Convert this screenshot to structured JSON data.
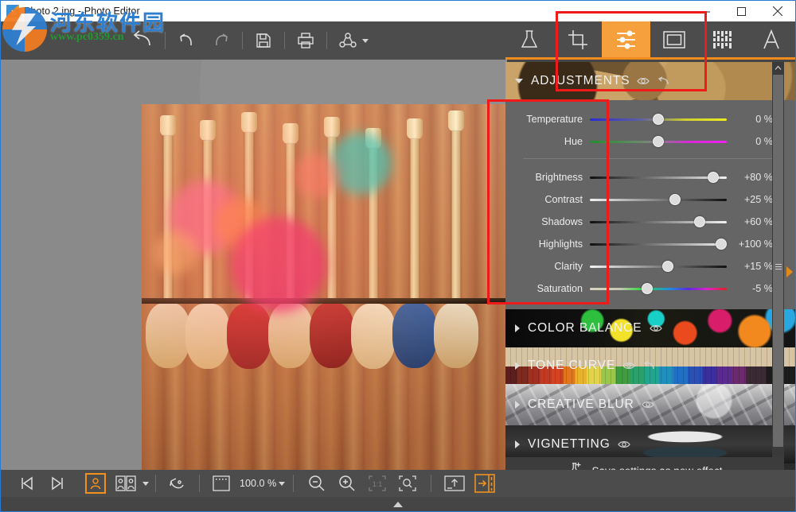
{
  "window": {
    "title": "Photo 2.jpg - Photo Editor",
    "app_icon": "photo-editor-icon",
    "controls": [
      {
        "name": "minimize",
        "glyph": "minimize-icon"
      },
      {
        "name": "maximize",
        "glyph": "maximize-icon"
      },
      {
        "name": "close",
        "glyph": "close-icon"
      }
    ]
  },
  "toolbar": {
    "items": [
      {
        "name": "back",
        "icon": "back-arrow-icon",
        "enabled": true
      },
      {
        "name": "undo",
        "icon": "undo-icon",
        "enabled": true
      },
      {
        "name": "redo",
        "icon": "redo-icon",
        "enabled": false
      },
      {
        "name": "save",
        "icon": "save-disk-icon",
        "enabled": true
      },
      {
        "name": "print",
        "icon": "printer-icon",
        "enabled": true
      },
      {
        "name": "share",
        "icon": "share-nodes-icon",
        "enabled": true
      }
    ],
    "cart_icon": "shopping-cart-icon"
  },
  "tabs": [
    {
      "name": "effects",
      "icon": "flask-icon",
      "active": false
    },
    {
      "name": "crop",
      "icon": "crop-icon",
      "active": false
    },
    {
      "name": "adjustments",
      "icon": "sliders-icon",
      "active": true
    },
    {
      "name": "frames",
      "icon": "frame-icon",
      "active": false
    },
    {
      "name": "textures",
      "icon": "texture-grid-icon",
      "active": false
    },
    {
      "name": "text",
      "icon": "text-a-icon",
      "active": false
    }
  ],
  "panel": {
    "active_accent": "#f5a03c",
    "sections": [
      {
        "label": "ADJUSTMENTS",
        "expanded": true,
        "texture": "gears",
        "icons": [
          "eye-icon",
          "reset-icon"
        ]
      },
      {
        "label": "COLOR BALANCE",
        "expanded": false,
        "texture": "paint",
        "icons": [
          "eye-icon"
        ]
      },
      {
        "label": "TONE CURVE",
        "expanded": false,
        "texture": "pencils",
        "icons": [
          "eye-icon",
          "reset-icon"
        ]
      },
      {
        "label": "CREATIVE BLUR",
        "expanded": false,
        "texture": "street",
        "icons": [
          "eye-icon"
        ]
      },
      {
        "label": "VIGNETTING",
        "expanded": false,
        "texture": "bow",
        "icons": [
          "eye-icon"
        ]
      }
    ],
    "sliders": [
      {
        "label": "Temperature",
        "value": "0 %",
        "pos": 50,
        "track": "blue-yellow"
      },
      {
        "label": "Hue",
        "value": "0 %",
        "pos": 50,
        "track": "green-magenta"
      },
      {
        "label": "Brightness",
        "value": "+80 %",
        "pos": 90,
        "track": "black-white"
      },
      {
        "label": "Contrast",
        "value": "+25 %",
        "pos": 62,
        "track": "white-black"
      },
      {
        "label": "Shadows",
        "value": "+60 %",
        "pos": 80,
        "track": "black-white"
      },
      {
        "label": "Highlights",
        "value": "+100 %",
        "pos": 100,
        "track": "black-white"
      },
      {
        "label": "Clarity",
        "value": "+15 %",
        "pos": 57,
        "track": "white-black"
      },
      {
        "label": "Saturation",
        "value": "-5 %",
        "pos": 42,
        "track": "rainbow"
      }
    ],
    "save_button": {
      "label": "Save settings as new effect",
      "icon": "flask-plus-icon"
    },
    "scrollbar": {
      "up_icon": "chevron-up-icon",
      "down_icon": "chevron-down-icon",
      "collapse_icon": "collapse-right-arrow-icon"
    }
  },
  "bottombar": {
    "items": [
      {
        "name": "previous-image",
        "icon": "skip-previous-icon",
        "state": "normal"
      },
      {
        "name": "next-image",
        "icon": "skip-next-icon",
        "state": "normal"
      },
      {
        "name": "single-view",
        "icon": "portrait-icon",
        "state": "active"
      },
      {
        "name": "compare-view",
        "icon": "before-after-icon",
        "state": "normal",
        "has_dropdown": true
      },
      {
        "name": "rotate",
        "icon": "rotate-icon",
        "state": "normal"
      },
      {
        "name": "fit-selection",
        "icon": "marquee-icon",
        "state": "normal"
      }
    ],
    "zoom": {
      "value": "100.0 %",
      "has_dropdown": true
    },
    "zoom_items": [
      {
        "name": "zoom-out",
        "icon": "magnifier-minus-icon",
        "state": "normal"
      },
      {
        "name": "zoom-in",
        "icon": "magnifier-plus-icon",
        "state": "normal"
      },
      {
        "name": "actual-size",
        "icon": "one-to-one-icon",
        "state": "disabled"
      },
      {
        "name": "fit-to-window",
        "icon": "magnifier-fit-icon",
        "state": "normal"
      }
    ],
    "right_items": [
      {
        "name": "export",
        "icon": "export-up-icon",
        "state": "normal"
      },
      {
        "name": "toggle-panel",
        "icon": "toggle-panel-icon",
        "state": "active"
      }
    ],
    "expand_filmstrip_icon": "chevron-up-icon"
  },
  "canvas": {
    "image_name": "guitars-on-wall-photo",
    "background": "#8a8a8a"
  },
  "watermark": {
    "text_cn": "河东软件园",
    "url": "www.pc0359.cn"
  },
  "annotations": [
    {
      "name": "annotation-tabs-box",
      "color": "#ef1b1b"
    },
    {
      "name": "annotation-sliders-box",
      "color": "#ef1b1b"
    }
  ]
}
